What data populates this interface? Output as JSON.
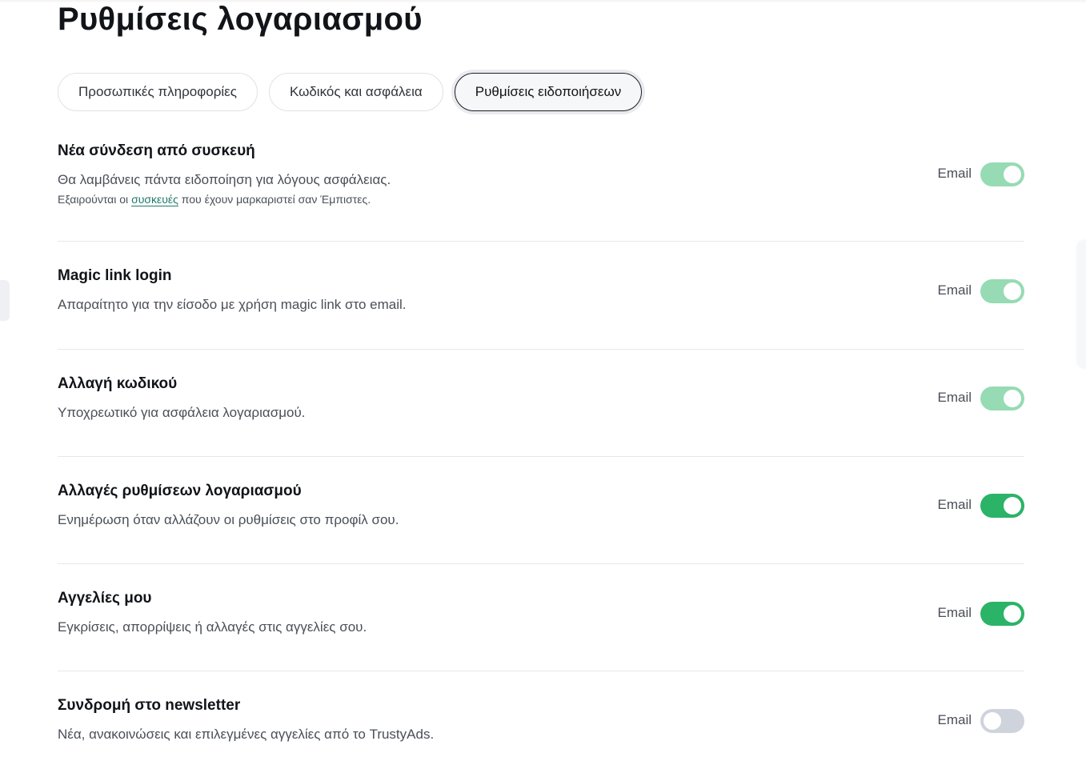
{
  "page": {
    "title": "Ρυθμίσεις λογαριασμού"
  },
  "tabs": [
    {
      "label": "Προσωπικές πληροφορίες",
      "active": false
    },
    {
      "label": "Κωδικός και ασφάλεια",
      "active": false
    },
    {
      "label": "Ρυθμίσεις ειδοποιήσεων",
      "active": true
    }
  ],
  "colors": {
    "toggle_on": "#2bb367",
    "toggle_locked": "#96dbb3",
    "toggle_off": "#cfd4dc",
    "link": "#1f7a6a"
  },
  "notifications": [
    {
      "title": "Νέα σύνδεση από συσκευή",
      "description": "Θα λαμβάνεις πάντα ειδοποίηση για λόγους ασφάλειας.",
      "note_prefix": "Εξαιρούνται οι ",
      "note_link": "συσκευές",
      "note_suffix": " που έχουν μαρκαριστεί σαν Έμπιστες.",
      "channel": "Email",
      "enabled": true,
      "locked": true
    },
    {
      "title": "Magic link login",
      "description": "Απαραίτητο για την είσοδο με χρήση magic link στο email.",
      "channel": "Email",
      "enabled": true,
      "locked": true
    },
    {
      "title": "Αλλαγή κωδικού",
      "description": "Υποχρεωτικό για ασφάλεια λογαριασμού.",
      "channel": "Email",
      "enabled": true,
      "locked": true
    },
    {
      "title": "Αλλαγές ρυθμίσεων λογαριασμού",
      "description": "Ενημέρωση όταν αλλάζουν οι ρυθμίσεις στο προφίλ σου.",
      "channel": "Email",
      "enabled": true,
      "locked": false
    },
    {
      "title": "Αγγελίες μου",
      "description": "Εγκρίσεις, απορρίψεις ή αλλαγές στις αγγελίες σου.",
      "channel": "Email",
      "enabled": true,
      "locked": false
    },
    {
      "title": "Συνδρομή στο newsletter",
      "description": "Νέα, ανακοινώσεις και επιλεγμένες αγγελίες από το TrustyAds.",
      "channel": "Email",
      "enabled": false,
      "locked": false
    }
  ]
}
